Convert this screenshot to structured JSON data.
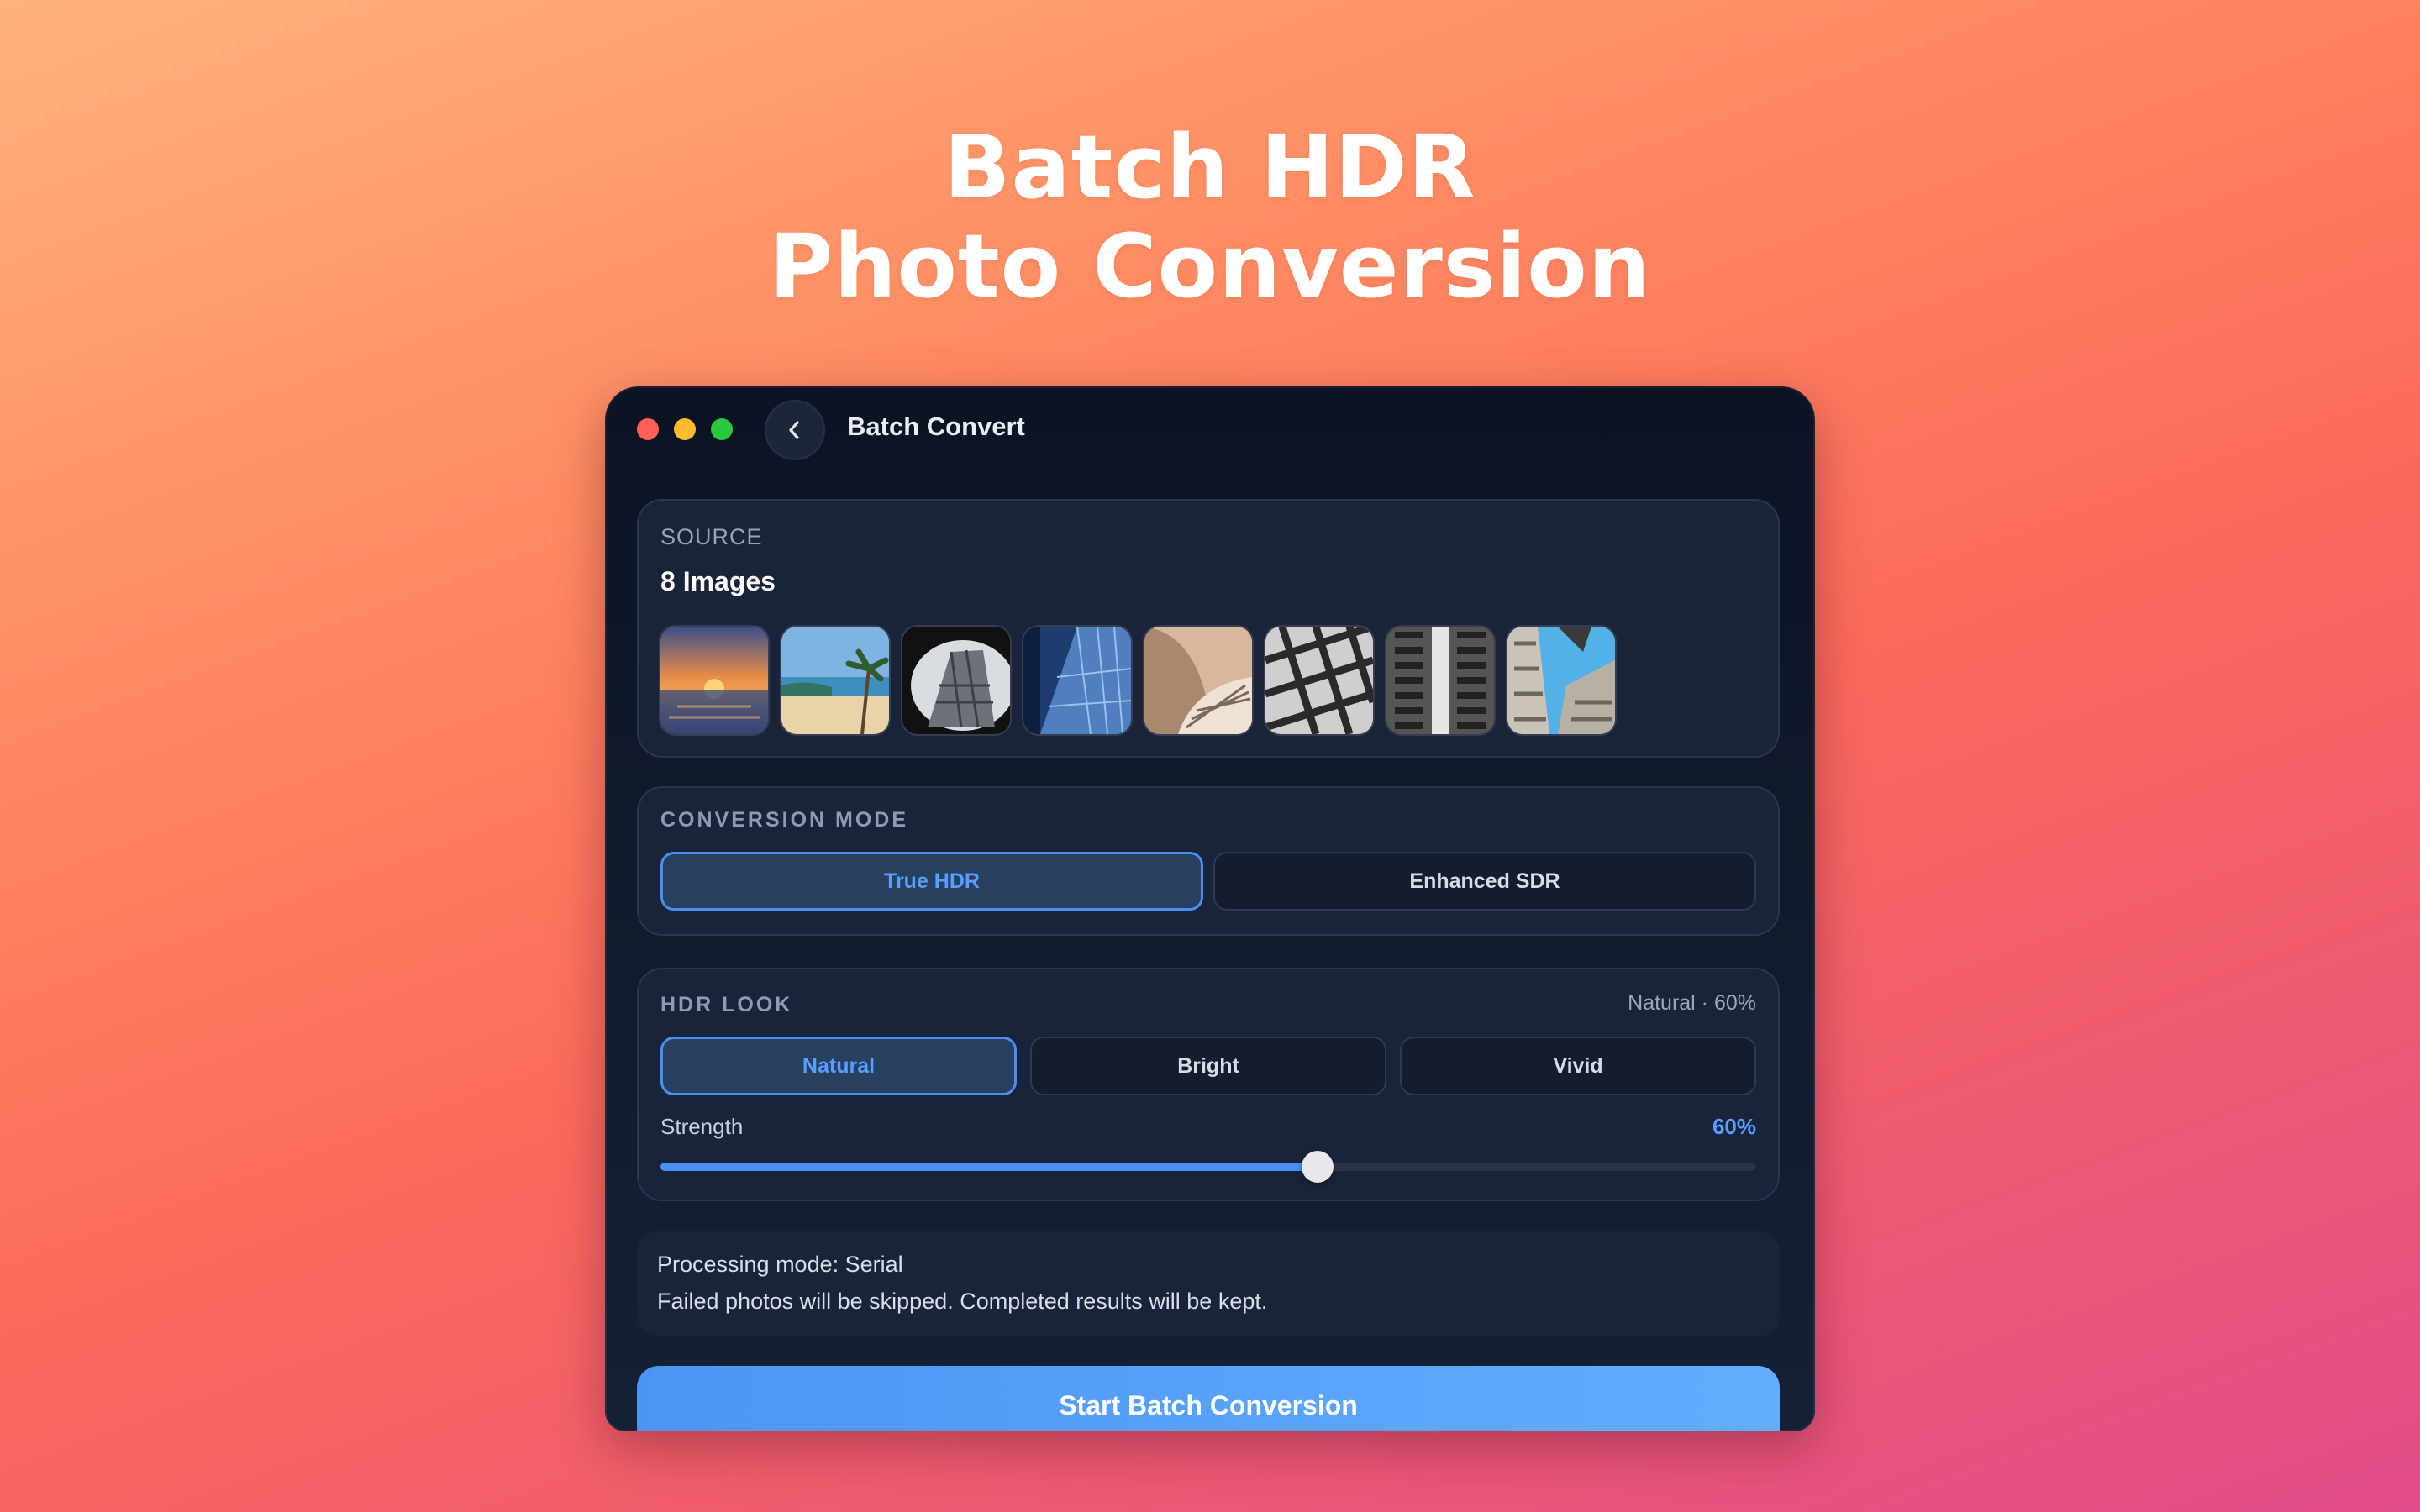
{
  "headline": {
    "line1": "Batch HDR",
    "line2": "Photo Conversion"
  },
  "window": {
    "title": "Batch Convert"
  },
  "source": {
    "label": "SOURCE",
    "count_text": "8 Images",
    "thumbnails": [
      "sunset-sea",
      "tropical-beach",
      "building-fisheye",
      "glass-skyscraper",
      "spiral-staircase",
      "bw-grid-facade",
      "bw-tower",
      "skyward-buildings"
    ]
  },
  "conversion_mode": {
    "label": "CONVERSION MODE",
    "options": [
      {
        "label": "True HDR",
        "selected": true
      },
      {
        "label": "Enhanced SDR",
        "selected": false
      }
    ]
  },
  "hdr_look": {
    "label": "HDR LOOK",
    "summary": "Natural · 60%",
    "options": [
      {
        "label": "Natural",
        "selected": true
      },
      {
        "label": "Bright",
        "selected": false
      },
      {
        "label": "Vivid",
        "selected": false
      }
    ],
    "strength_label": "Strength",
    "strength_value_text": "60%",
    "strength_fraction": 0.6
  },
  "info": {
    "processing_mode": "Processing mode: Serial",
    "note": "Failed photos will be skipped. Completed results will be kept."
  },
  "start_button": {
    "label": "Start Batch Conversion"
  },
  "colors": {
    "accent": "#4a90f0",
    "window_bg": "#111a2b",
    "card_bg": "#19233a"
  }
}
